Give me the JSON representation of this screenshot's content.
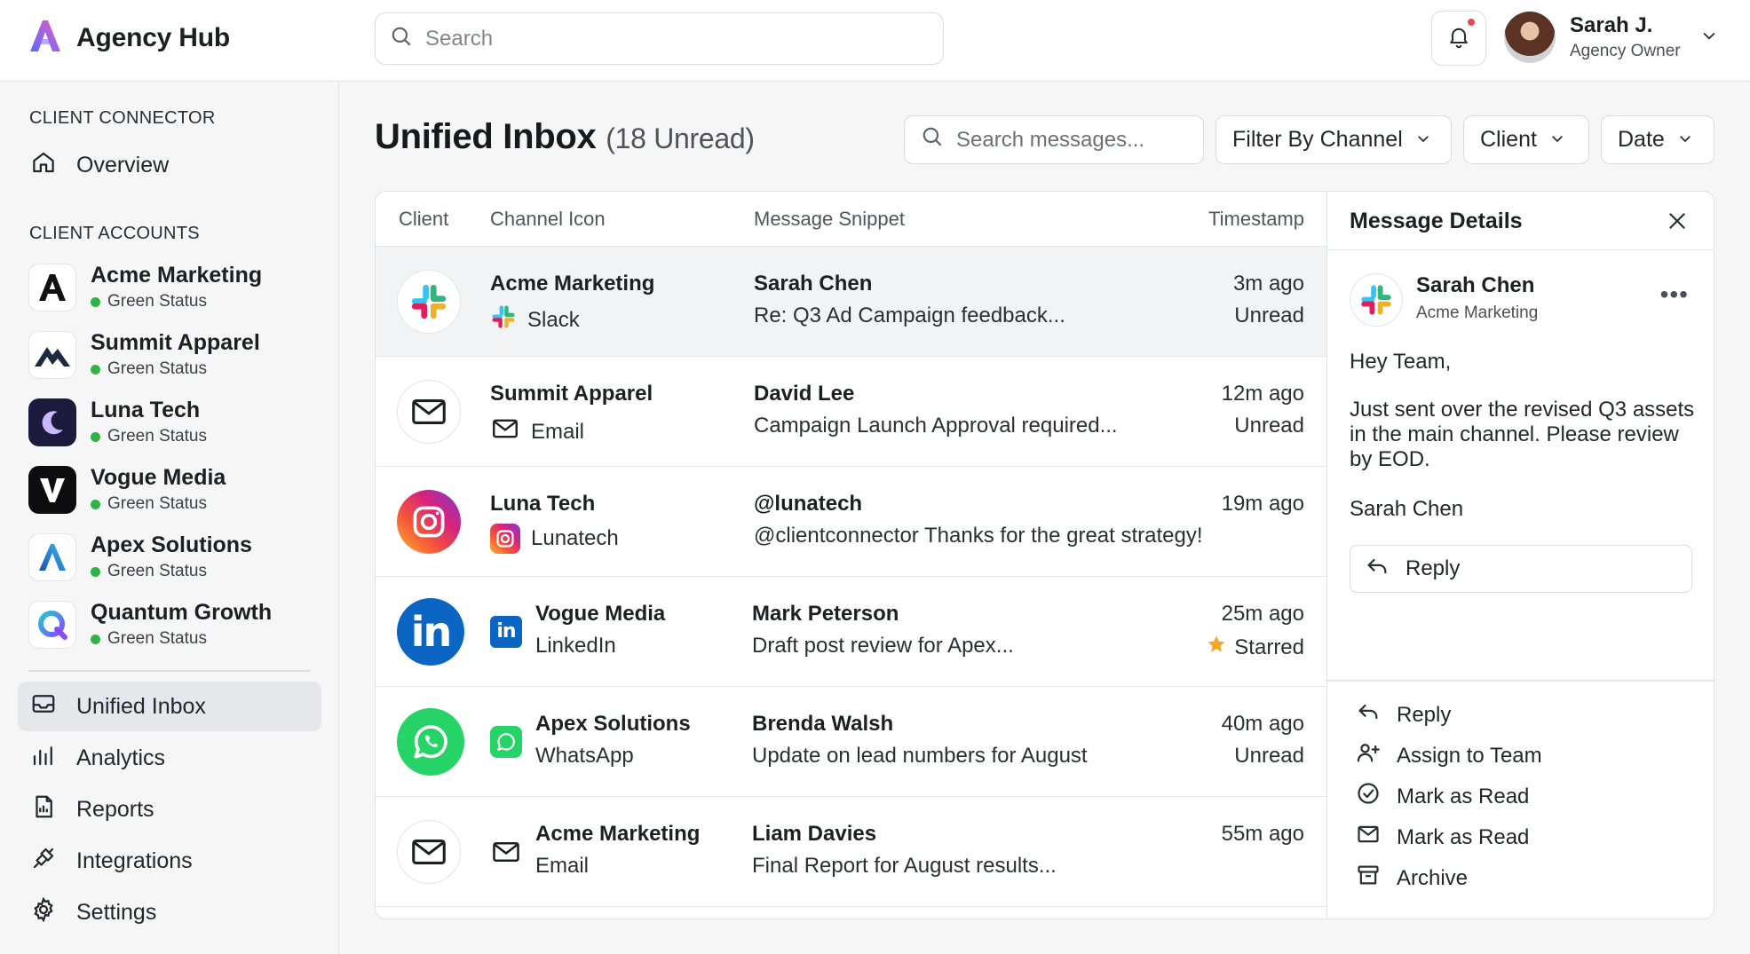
{
  "app": {
    "name": "Agency Hub"
  },
  "header": {
    "search_placeholder": "Search",
    "user": {
      "name": "Sarah J.",
      "role": "Agency Owner"
    }
  },
  "sidebar": {
    "section_connector": "CLIENT CONNECTOR",
    "overview": "Overview",
    "section_accounts": "CLIENT ACCOUNTS",
    "accounts": [
      {
        "name": "Acme Marketing",
        "status": "Green Status"
      },
      {
        "name": "Summit Apparel",
        "status": "Green Status"
      },
      {
        "name": "Luna Tech",
        "status": "Green Status"
      },
      {
        "name": "Vogue Media",
        "status": "Green Status"
      },
      {
        "name": "Apex Solutions",
        "status": "Green Status"
      },
      {
        "name": "Quantum Growth",
        "status": "Green Status"
      }
    ],
    "nav": [
      {
        "label": "Unified Inbox",
        "icon": "inbox-icon",
        "active": true
      },
      {
        "label": "Analytics",
        "icon": "analytics-icon"
      },
      {
        "label": "Reports",
        "icon": "reports-icon"
      },
      {
        "label": "Integrations",
        "icon": "integrations-icon"
      },
      {
        "label": "Settings",
        "icon": "settings-icon"
      }
    ]
  },
  "main": {
    "title": "Unified Inbox",
    "unread": "(18 Unread)",
    "search_placeholder": "Search messages...",
    "filter_channel": "Filter By Channel",
    "filter_client": "Client",
    "filter_date": "Date",
    "columns": {
      "client": "Client",
      "channel": "Channel Icon",
      "snippet": "Message Snippet",
      "timestamp": "Timestamp"
    },
    "messages": [
      {
        "client": "Acme Marketing",
        "channel": "Slack",
        "sender": "Sarah Chen",
        "snippet": "Re: Q3 Ad Campaign feedback...",
        "time": "3m ago",
        "status": "Unread"
      },
      {
        "client": "Summit Apparel",
        "channel": "Email",
        "sender": "David Lee",
        "snippet": "Campaign Launch Approval required...",
        "time": "12m ago",
        "status": "Unread"
      },
      {
        "client": "Luna Tech",
        "channel": "Lunatech",
        "sender": "@lunatech",
        "snippet": "@clientconnector Thanks for the great strategy!",
        "time": "19m ago",
        "status": ""
      },
      {
        "client": "Vogue Media",
        "channel": "LinkedIn",
        "sender": "Mark Peterson",
        "snippet": "Draft post review for Apex...",
        "time": "25m ago",
        "status": "Starred"
      },
      {
        "client": "Apex Solutions",
        "channel": "WhatsApp",
        "sender": "Brenda Walsh",
        "snippet": "Update on lead numbers for August",
        "time": "40m ago",
        "status": "Unread"
      },
      {
        "client": "Acme Marketing",
        "channel": "Email",
        "sender": "Liam Davies",
        "snippet": "Final Report for August results...",
        "time": "55m ago",
        "status": ""
      }
    ]
  },
  "details": {
    "title": "Message Details",
    "sender": "Sarah Chen",
    "client": "Acme Marketing",
    "greeting": "Hey Team,",
    "body": "Just sent over the revised Q3 assets in the main channel. Please review by EOD.",
    "signature": "Sarah Chen",
    "reply_button": "Reply",
    "actions": [
      {
        "label": "Reply",
        "icon": "reply-icon"
      },
      {
        "label": "Assign to Team",
        "icon": "assign-team-icon"
      },
      {
        "label": "Mark as Read",
        "icon": "check-circle-icon"
      },
      {
        "label": "Mark as Read",
        "icon": "mail-check-icon"
      },
      {
        "label": "Archive",
        "icon": "archive-icon"
      }
    ]
  },
  "colors": {
    "brand_gradient": [
      "#6a5cff",
      "#e25cc7"
    ],
    "status_green": "#2fb344",
    "notification_dot": "#e5484d",
    "star": "#f5a623",
    "linkedin": "#0a66c2",
    "whatsapp": "#25d366"
  }
}
